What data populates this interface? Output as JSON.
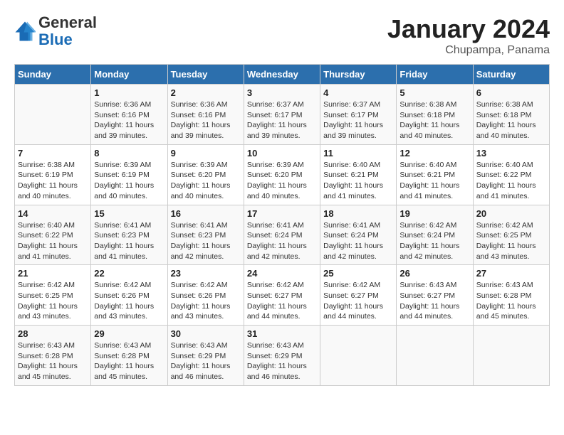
{
  "header": {
    "logo_line1": "General",
    "logo_line2": "Blue",
    "month": "January 2024",
    "location": "Chupampa, Panama"
  },
  "weekdays": [
    "Sunday",
    "Monday",
    "Tuesday",
    "Wednesday",
    "Thursday",
    "Friday",
    "Saturday"
  ],
  "weeks": [
    [
      {
        "day": "",
        "sunrise": "",
        "sunset": "",
        "daylight": ""
      },
      {
        "day": "1",
        "sunrise": "6:36 AM",
        "sunset": "6:16 PM",
        "daylight": "11 hours and 39 minutes."
      },
      {
        "day": "2",
        "sunrise": "6:36 AM",
        "sunset": "6:16 PM",
        "daylight": "11 hours and 39 minutes."
      },
      {
        "day": "3",
        "sunrise": "6:37 AM",
        "sunset": "6:17 PM",
        "daylight": "11 hours and 39 minutes."
      },
      {
        "day": "4",
        "sunrise": "6:37 AM",
        "sunset": "6:17 PM",
        "daylight": "11 hours and 39 minutes."
      },
      {
        "day": "5",
        "sunrise": "6:38 AM",
        "sunset": "6:18 PM",
        "daylight": "11 hours and 40 minutes."
      },
      {
        "day": "6",
        "sunrise": "6:38 AM",
        "sunset": "6:18 PM",
        "daylight": "11 hours and 40 minutes."
      }
    ],
    [
      {
        "day": "7",
        "sunrise": "6:38 AM",
        "sunset": "6:19 PM",
        "daylight": "11 hours and 40 minutes."
      },
      {
        "day": "8",
        "sunrise": "6:39 AM",
        "sunset": "6:19 PM",
        "daylight": "11 hours and 40 minutes."
      },
      {
        "day": "9",
        "sunrise": "6:39 AM",
        "sunset": "6:20 PM",
        "daylight": "11 hours and 40 minutes."
      },
      {
        "day": "10",
        "sunrise": "6:39 AM",
        "sunset": "6:20 PM",
        "daylight": "11 hours and 40 minutes."
      },
      {
        "day": "11",
        "sunrise": "6:40 AM",
        "sunset": "6:21 PM",
        "daylight": "11 hours and 41 minutes."
      },
      {
        "day": "12",
        "sunrise": "6:40 AM",
        "sunset": "6:21 PM",
        "daylight": "11 hours and 41 minutes."
      },
      {
        "day": "13",
        "sunrise": "6:40 AM",
        "sunset": "6:22 PM",
        "daylight": "11 hours and 41 minutes."
      }
    ],
    [
      {
        "day": "14",
        "sunrise": "6:40 AM",
        "sunset": "6:22 PM",
        "daylight": "11 hours and 41 minutes."
      },
      {
        "day": "15",
        "sunrise": "6:41 AM",
        "sunset": "6:23 PM",
        "daylight": "11 hours and 41 minutes."
      },
      {
        "day": "16",
        "sunrise": "6:41 AM",
        "sunset": "6:23 PM",
        "daylight": "11 hours and 42 minutes."
      },
      {
        "day": "17",
        "sunrise": "6:41 AM",
        "sunset": "6:24 PM",
        "daylight": "11 hours and 42 minutes."
      },
      {
        "day": "18",
        "sunrise": "6:41 AM",
        "sunset": "6:24 PM",
        "daylight": "11 hours and 42 minutes."
      },
      {
        "day": "19",
        "sunrise": "6:42 AM",
        "sunset": "6:24 PM",
        "daylight": "11 hours and 42 minutes."
      },
      {
        "day": "20",
        "sunrise": "6:42 AM",
        "sunset": "6:25 PM",
        "daylight": "11 hours and 43 minutes."
      }
    ],
    [
      {
        "day": "21",
        "sunrise": "6:42 AM",
        "sunset": "6:25 PM",
        "daylight": "11 hours and 43 minutes."
      },
      {
        "day": "22",
        "sunrise": "6:42 AM",
        "sunset": "6:26 PM",
        "daylight": "11 hours and 43 minutes."
      },
      {
        "day": "23",
        "sunrise": "6:42 AM",
        "sunset": "6:26 PM",
        "daylight": "11 hours and 43 minutes."
      },
      {
        "day": "24",
        "sunrise": "6:42 AM",
        "sunset": "6:27 PM",
        "daylight": "11 hours and 44 minutes."
      },
      {
        "day": "25",
        "sunrise": "6:42 AM",
        "sunset": "6:27 PM",
        "daylight": "11 hours and 44 minutes."
      },
      {
        "day": "26",
        "sunrise": "6:43 AM",
        "sunset": "6:27 PM",
        "daylight": "11 hours and 44 minutes."
      },
      {
        "day": "27",
        "sunrise": "6:43 AM",
        "sunset": "6:28 PM",
        "daylight": "11 hours and 45 minutes."
      }
    ],
    [
      {
        "day": "28",
        "sunrise": "6:43 AM",
        "sunset": "6:28 PM",
        "daylight": "11 hours and 45 minutes."
      },
      {
        "day": "29",
        "sunrise": "6:43 AM",
        "sunset": "6:28 PM",
        "daylight": "11 hours and 45 minutes."
      },
      {
        "day": "30",
        "sunrise": "6:43 AM",
        "sunset": "6:29 PM",
        "daylight": "11 hours and 46 minutes."
      },
      {
        "day": "31",
        "sunrise": "6:43 AM",
        "sunset": "6:29 PM",
        "daylight": "11 hours and 46 minutes."
      },
      {
        "day": "",
        "sunrise": "",
        "sunset": "",
        "daylight": ""
      },
      {
        "day": "",
        "sunrise": "",
        "sunset": "",
        "daylight": ""
      },
      {
        "day": "",
        "sunrise": "",
        "sunset": "",
        "daylight": ""
      }
    ]
  ]
}
